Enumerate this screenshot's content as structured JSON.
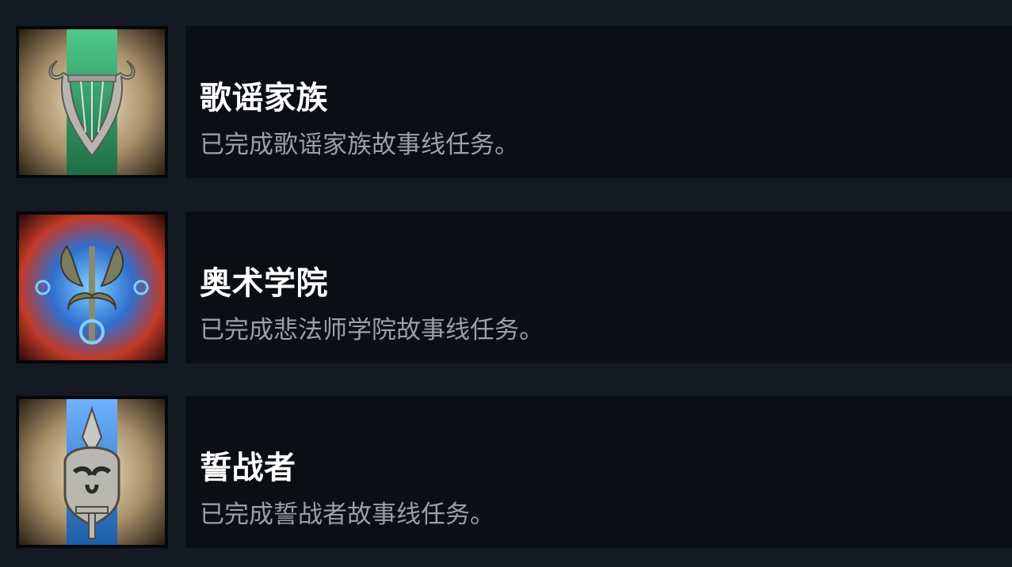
{
  "achievements": [
    {
      "title": "歌谣家族",
      "description": "已完成歌谣家族故事线任务。",
      "icon": "lyre-icon",
      "accent": "#2f8a55"
    },
    {
      "title": "奥术学院",
      "description": "已完成悲法师学院故事线任务。",
      "icon": "arcane-sigil-icon",
      "accent": "#2f8fd8"
    },
    {
      "title": "誓战者",
      "description": "已完成誓战者故事线任务。",
      "icon": "helmet-sword-icon",
      "accent": "#2f7fc8"
    }
  ]
}
